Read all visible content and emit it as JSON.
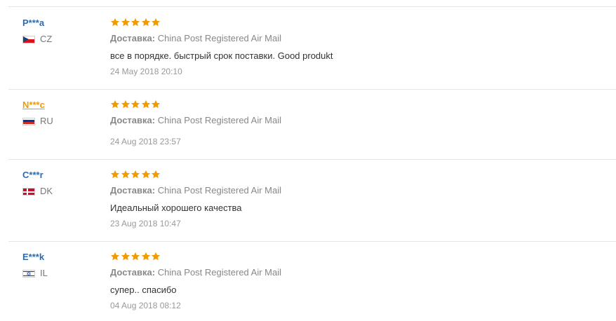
{
  "colors": {
    "star": "#f29b00",
    "user_link": "#2a6db3",
    "user_link_hover": "#f29b00",
    "divider": "#e5e5e5"
  },
  "reviews": [
    {
      "user": "P***a",
      "country": "CZ",
      "flag_icon": "czech-flag-icon",
      "rating": 5,
      "shipping_label": "Доставка:",
      "shipping_method": "China Post Registered Air Mail",
      "comment": "все в порядке. быстрый срок поставки. Good produkt",
      "date": "24 May 2018 20:10"
    },
    {
      "user": "N***c",
      "user_hovered": true,
      "country": "RU",
      "flag_icon": "russia-flag-icon",
      "rating": 5,
      "shipping_label": "Доставка:",
      "shipping_method": "China Post Registered Air Mail",
      "comment": "",
      "date": "24 Aug 2018 23:57"
    },
    {
      "user": "C***r",
      "country": "DK",
      "flag_icon": "denmark-flag-icon",
      "rating": 5,
      "shipping_label": "Доставка:",
      "shipping_method": "China Post Registered Air Mail",
      "comment": "Идеальный хорошего качества",
      "date": "23 Aug 2018 10:47"
    },
    {
      "user": "E***k",
      "country": "IL",
      "flag_icon": "israel-flag-icon",
      "rating": 5,
      "shipping_label": "Доставка:",
      "shipping_method": "China Post Registered Air Mail",
      "comment": "супер.. спасибо",
      "date": "04 Aug 2018 08:12"
    }
  ]
}
